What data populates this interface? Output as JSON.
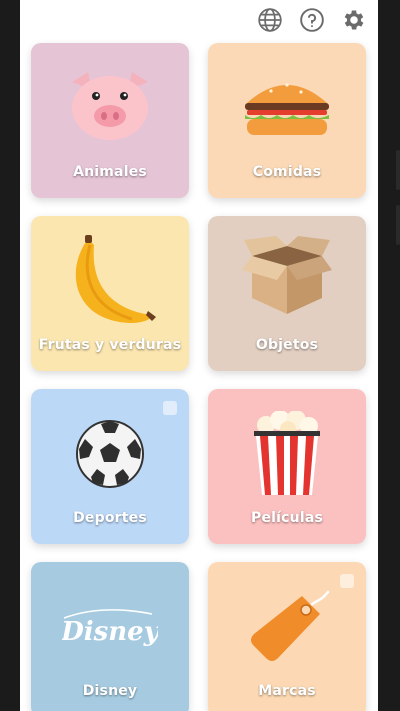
{
  "toolbar": {
    "language_icon": "globe-icon",
    "help_icon": "help-icon",
    "settings_icon": "gear-icon"
  },
  "categories": [
    {
      "label": "Animales",
      "color": "#e5c4d6",
      "icon": "pig-icon"
    },
    {
      "label": "Comidas",
      "color": "#fbd9b6",
      "icon": "burger-icon"
    },
    {
      "label": "Frutas y verduras",
      "color": "#fbe6b0",
      "icon": "banana-icon"
    },
    {
      "label": "Objetos",
      "color": "#e2cfc2",
      "icon": "box-icon"
    },
    {
      "label": "Deportes",
      "color": "#bcd8f7",
      "icon": "soccer-ball-icon"
    },
    {
      "label": "Películas",
      "color": "#fbc0c0",
      "icon": "popcorn-icon"
    },
    {
      "label": "Disney",
      "color": "#a6cbe0",
      "icon": "disney-logo"
    },
    {
      "label": "Marcas",
      "color": "#fcd9b4",
      "icon": "price-tag-icon"
    }
  ]
}
